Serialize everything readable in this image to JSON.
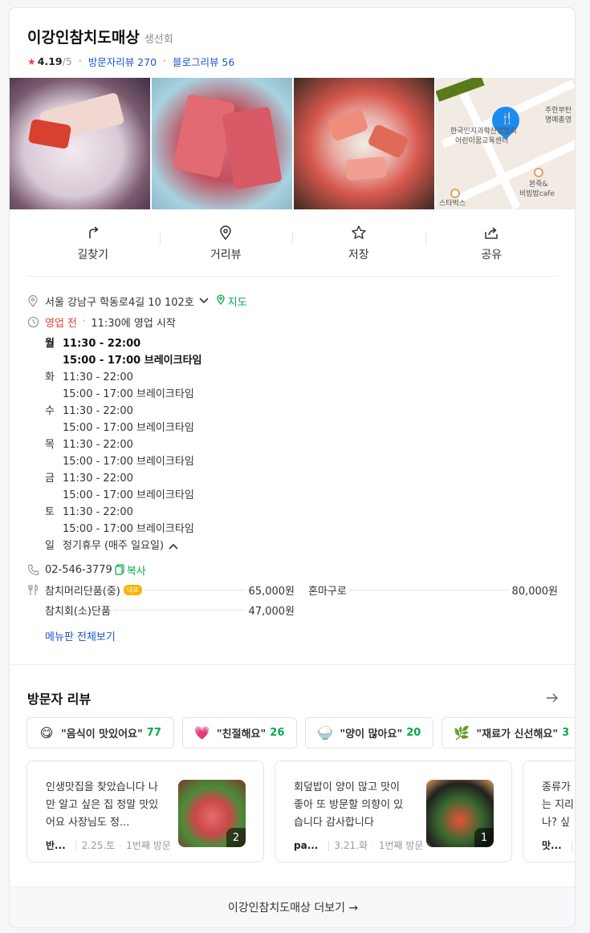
{
  "place": {
    "name": "이강인참치도매상",
    "category": "생선회",
    "rating": "4.19",
    "rating_max": "/5",
    "visitor_reviews": "방문자리뷰 270",
    "blog_reviews": "블로그리뷰 56"
  },
  "map": {
    "labels": [
      "한국인지과학산업협회",
      "어린이꿈교육센터",
      "주한부탄",
      "명예총영",
      "본죽&",
      "비빔밥cafe",
      "스타벅스"
    ]
  },
  "actions": [
    {
      "label": "길찾기",
      "icon": "directions-icon"
    },
    {
      "label": "거리뷰",
      "icon": "location-pin-icon"
    },
    {
      "label": "저장",
      "icon": "star-icon"
    },
    {
      "label": "공유",
      "icon": "share-icon"
    }
  ],
  "info": {
    "address": "서울 강남구 학동로4길 10 102호",
    "map_link": "지도",
    "status": "영업 전",
    "status_detail": "11:30에 영업 시작",
    "hours": [
      {
        "day": "월",
        "open": "11:30 - 22:00",
        "break": "15:00 - 17:00 브레이크타임",
        "bold": true
      },
      {
        "day": "화",
        "open": "11:30 - 22:00",
        "break": "15:00 - 17:00 브레이크타임",
        "bold": false
      },
      {
        "day": "수",
        "open": "11:30 - 22:00",
        "break": "15:00 - 17:00 브레이크타임",
        "bold": false
      },
      {
        "day": "목",
        "open": "11:30 - 22:00",
        "break": "15:00 - 17:00 브레이크타임",
        "bold": false
      },
      {
        "day": "금",
        "open": "11:30 - 22:00",
        "break": "15:00 - 17:00 브레이크타임",
        "bold": false
      },
      {
        "day": "토",
        "open": "11:30 - 22:00",
        "break": "15:00 - 17:00 브레이크타임",
        "bold": false
      }
    ],
    "sunday_day": "일",
    "sunday_text": "정기휴무 (매주 일요일)",
    "phone": "02-546-3779",
    "copy_label": "복사",
    "menu": [
      {
        "name": "참치머리단품(중)",
        "badge": "대표",
        "price": "65,000원"
      },
      {
        "name": "혼마구로",
        "badge": "",
        "price": "80,000원"
      },
      {
        "name": "참치회(소)단품",
        "badge": "",
        "price": "47,000원"
      }
    ],
    "menu_link": "메뉴판 전체보기"
  },
  "reviews": {
    "title": "방문자 리뷰",
    "chips": [
      {
        "text": "\"음식이 맛있어요\"",
        "count": "77",
        "emoji": "😋"
      },
      {
        "text": "\"친절해요\"",
        "count": "26",
        "emoji": "💗"
      },
      {
        "text": "\"양이 많아요\"",
        "count": "20",
        "emoji": "🍚"
      },
      {
        "text": "\"재료가 신선해요\"",
        "count": "3",
        "emoji": "🌿"
      }
    ],
    "cards": [
      {
        "text": "인생맛집을 찾았습니다 나만 알고 싶은 집 정말 맛있어요 사장님도 정...",
        "user": "반...",
        "date": "2.25.토",
        "visit": "1번째 방문",
        "photos": "2"
      },
      {
        "text": "회덮밥이 양이 많고 맛이 좋아 또 방문할 의향이 있습니다 감사합니다",
        "user": "pa...",
        "date": "3.21.화",
        "visit": "1번째 방문",
        "photos": "1"
      },
      {
        "text": "종류가 는 지리 나? 싶었",
        "user": "맛...",
        "date": "",
        "visit": "",
        "photos": ""
      }
    ]
  },
  "footer": {
    "label": "이강인참치도매상 더보기 →"
  }
}
